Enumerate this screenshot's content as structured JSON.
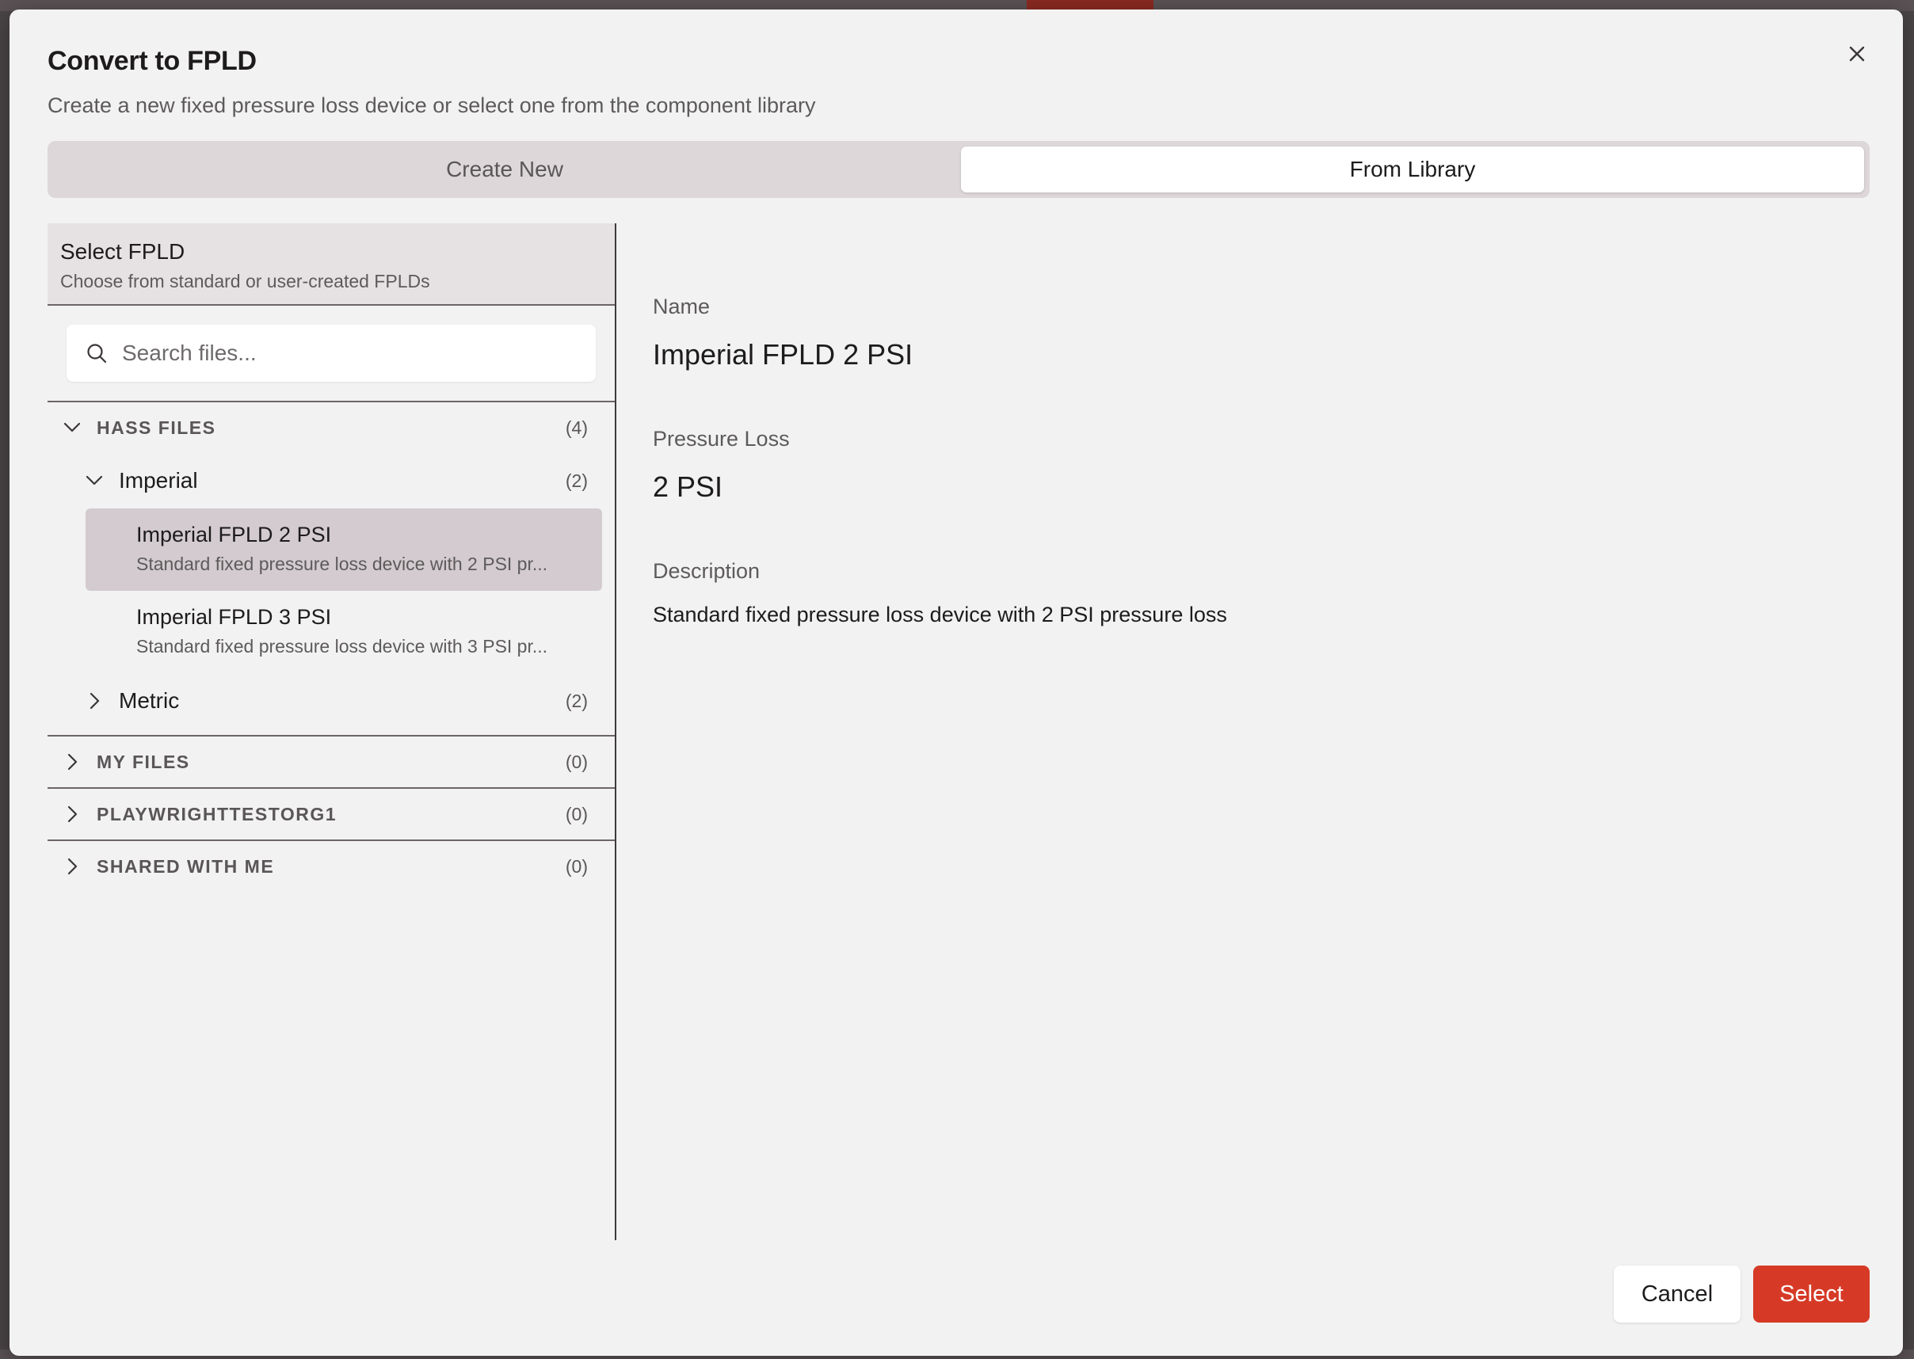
{
  "dialog": {
    "title": "Convert to FPLD",
    "subtitle": "Create a new fixed pressure loss device or select one from the component library"
  },
  "tabs": [
    {
      "label": "Create New",
      "active": false
    },
    {
      "label": "From Library",
      "active": true
    }
  ],
  "left_panel": {
    "title": "Select FPLD",
    "subtitle": "Choose from standard or user-created FPLDs",
    "search": {
      "placeholder": "Search files...",
      "value": ""
    },
    "groups": [
      {
        "label": "HASS FILES",
        "count": "(4)",
        "expanded": true,
        "subgroups": [
          {
            "label": "Imperial",
            "count": "(2)",
            "expanded": true,
            "items": [
              {
                "title": "Imperial FPLD 2 PSI",
                "description": "Standard fixed pressure loss device with 2 PSI pr...",
                "selected": true
              },
              {
                "title": "Imperial FPLD 3 PSI",
                "description": "Standard fixed pressure loss device with 3 PSI pr...",
                "selected": false
              }
            ]
          },
          {
            "label": "Metric",
            "count": "(2)",
            "expanded": false
          }
        ]
      },
      {
        "label": "MY FILES",
        "count": "(0)",
        "expanded": false
      },
      {
        "label": "PLAYWRIGHTTESTORG1",
        "count": "(0)",
        "expanded": false
      },
      {
        "label": "SHARED WITH ME",
        "count": "(0)",
        "expanded": false
      }
    ]
  },
  "detail": {
    "name_label": "Name",
    "name_value": "Imperial FPLD 2 PSI",
    "pressure_label": "Pressure Loss",
    "pressure_value": "2 PSI",
    "description_label": "Description",
    "description_value": "Standard fixed pressure loss device with 2 PSI pressure loss"
  },
  "footer": {
    "cancel_label": "Cancel",
    "select_label": "Select"
  },
  "icons": {
    "close": "close-icon",
    "search": "search-icon",
    "expanded": "chevron-down-icon",
    "collapsed": "chevron-right-icon"
  },
  "colors": {
    "accent": "#d63a26",
    "selected_row": "#d3cbcf",
    "dialog_bg": "#f2f2f2"
  }
}
